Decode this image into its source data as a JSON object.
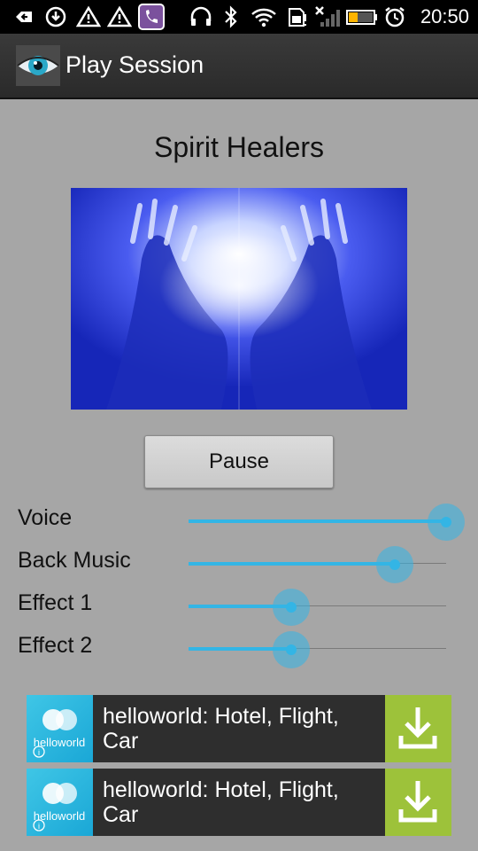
{
  "status_bar": {
    "time": "20:50",
    "icons": [
      "back-arrow-icon",
      "download-icon",
      "warning-icon",
      "warning-icon",
      "viber-icon",
      "headset-icon",
      "bluetooth-icon",
      "wifi-icon",
      "sd-card-icon",
      "no-signal-icon",
      "battery-icon",
      "alarm-icon"
    ]
  },
  "action_bar": {
    "title": "Play Session",
    "icon": "eye-icon"
  },
  "session": {
    "title": "Spirit Healers",
    "image": "glowing-hands-image"
  },
  "controls": {
    "pause_label": "Pause"
  },
  "sliders": [
    {
      "label": "Voice",
      "value": 1.0
    },
    {
      "label": "Back Music",
      "value": 0.8
    },
    {
      "label": "Effect 1",
      "value": 0.4
    },
    {
      "label": "Effect 2",
      "value": 0.4
    }
  ],
  "ads": [
    {
      "title": "helloworld: Hotel, Flight, Car",
      "logo_text": "helloworld",
      "icon": "download-icon"
    },
    {
      "title": "helloworld: Hotel, Flight, Car",
      "logo_text": "helloworld",
      "icon": "download-icon"
    }
  ],
  "colors": {
    "background": "#a6a6a6",
    "accent": "#33b5e5",
    "ad_download": "#9dc23a",
    "ad_logo": "#1aa7d6"
  }
}
